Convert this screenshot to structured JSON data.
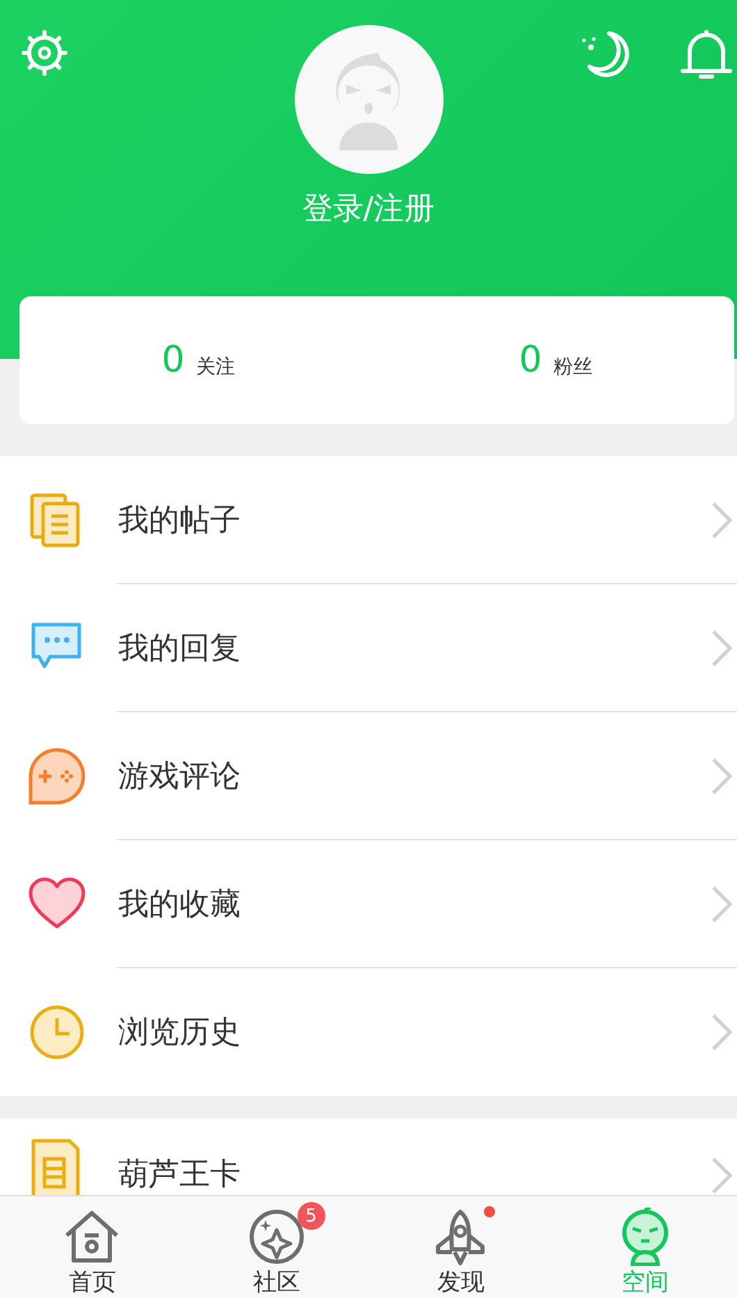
{
  "header": {
    "login": "登录/注册"
  },
  "stats": [
    {
      "value": "0",
      "label": "关注"
    },
    {
      "value": "0",
      "label": "粉丝"
    }
  ],
  "sections": [
    {
      "items": [
        {
          "kind": "posts",
          "label": "我的帖子"
        },
        {
          "kind": "replies",
          "label": "我的回复"
        },
        {
          "kind": "reviews",
          "label": "游戏评论"
        },
        {
          "kind": "favorites",
          "label": "我的收藏"
        },
        {
          "kind": "history",
          "label": "浏览历史"
        }
      ]
    },
    {
      "items": [
        {
          "kind": "card",
          "label": "葫芦王卡"
        }
      ]
    }
  ],
  "tabs": [
    {
      "kind": "home",
      "label": "首页",
      "selected": false,
      "dot": false
    },
    {
      "kind": "community",
      "label": "社区",
      "selected": false,
      "badge": "5",
      "dot": false
    },
    {
      "kind": "discover",
      "label": "发现",
      "selected": false,
      "dot": true
    },
    {
      "kind": "space",
      "label": "空间",
      "selected": true,
      "dot": false
    }
  ]
}
